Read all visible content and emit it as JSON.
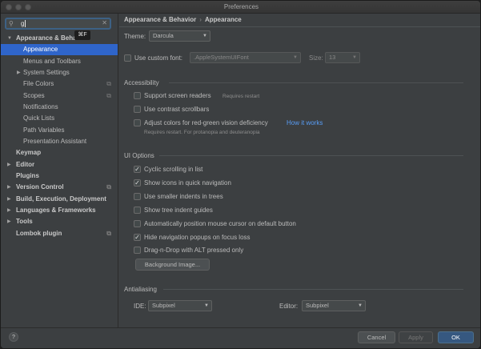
{
  "window": {
    "title": "Preferences"
  },
  "search": {
    "value": "g",
    "tooltip": "⌘F"
  },
  "sidebar": {
    "items": [
      {
        "label": "Appearance & Behavior",
        "bold": true,
        "arrow": "▼"
      },
      {
        "label": "Appearance",
        "selected": true
      },
      {
        "label": "Menus and Toolbars"
      },
      {
        "label": "System Settings",
        "arrow": "▶"
      },
      {
        "label": "File Colors",
        "copy": true
      },
      {
        "label": "Scopes",
        "copy": true
      },
      {
        "label": "Notifications"
      },
      {
        "label": "Quick Lists"
      },
      {
        "label": "Path Variables"
      },
      {
        "label": "Presentation Assistant"
      },
      {
        "label": "Keymap",
        "bold": true
      },
      {
        "label": "Editor",
        "bold": true,
        "arrow": "▶"
      },
      {
        "label": "Plugins",
        "bold": true
      },
      {
        "label": "Version Control",
        "bold": true,
        "arrow": "▶",
        "copy": true
      },
      {
        "label": "Build, Execution, Deployment",
        "bold": true,
        "arrow": "▶"
      },
      {
        "label": "Languages & Frameworks",
        "bold": true,
        "arrow": "▶"
      },
      {
        "label": "Tools",
        "bold": true,
        "arrow": "▶"
      },
      {
        "label": "Lombok plugin",
        "bold": true,
        "copy": true
      }
    ]
  },
  "breadcrumb": {
    "parent": "Appearance & Behavior",
    "separator": "›",
    "current": "Appearance"
  },
  "theme": {
    "label": "Theme:",
    "value": "Darcula"
  },
  "custom_font": {
    "label": "Use custom font:",
    "checked": false,
    "font_value": ".AppleSystemUIFont",
    "size_label": "Size:",
    "size_value": "13"
  },
  "accessibility": {
    "title": "Accessibility",
    "screen_readers": {
      "label": "Support screen readers",
      "note": "Requires restart",
      "checked": false
    },
    "contrast_scrollbars": {
      "label": "Use contrast scrollbars",
      "checked": false
    },
    "color_deficiency": {
      "label": "Adjust colors for red-green vision deficiency",
      "link": "How it works",
      "note": "Requires restart. For protanopia and deuteranopia",
      "checked": false
    }
  },
  "ui_options": {
    "title": "UI Options",
    "cyclic_scrolling": {
      "label": "Cyclic scrolling in list",
      "checked": true
    },
    "quick_nav_icons": {
      "label": "Show icons in quick navigation",
      "checked": true
    },
    "smaller_indents": {
      "label": "Use smaller indents in trees",
      "checked": false
    },
    "tree_guides": {
      "label": "Show tree indent guides",
      "checked": false
    },
    "mouse_default_button": {
      "label": "Automatically position mouse cursor on default button",
      "checked": false
    },
    "hide_nav_popups": {
      "label": "Hide navigation popups on focus loss",
      "checked": true
    },
    "drag_drop_alt": {
      "label": "Drag-n-Drop with ALT pressed only",
      "checked": false
    },
    "background_image_button": "Background Image..."
  },
  "antialiasing": {
    "title": "Antialiasing",
    "ide_label": "IDE:",
    "ide_value": "Subpixel",
    "editor_label": "Editor:",
    "editor_value": "Subpixel"
  },
  "footer": {
    "help": "?",
    "cancel": "Cancel",
    "apply": "Apply",
    "ok": "OK"
  },
  "icons": {
    "check": "✓",
    "dropdown": "▼",
    "search": "search-icon",
    "copy": "⧉"
  },
  "colors": {
    "accent": "#2f65ca",
    "link": "#589df6",
    "primary_button": "#365880"
  }
}
